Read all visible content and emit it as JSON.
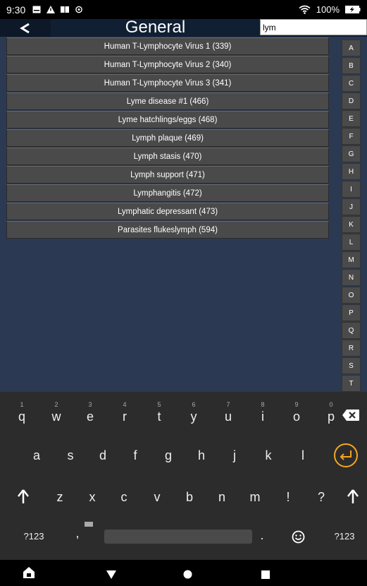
{
  "status_bar": {
    "time": "9:30",
    "battery": "100%"
  },
  "header": {
    "back_label": "<",
    "title": "General",
    "search_value": "lym"
  },
  "results": [
    "Human T-Lymphocyte Virus 1 (339)",
    "Human T-Lymphocyte Virus 2 (340)",
    "Human T-Lymphocyte Virus 3 (341)",
    "Lyme disease #1 (466)",
    "Lyme hatchlings/eggs (468)",
    "Lymph plaque (469)",
    "Lymph stasis (470)",
    "Lymph support (471)",
    "Lymphangitis (472)",
    "Lymphatic depressant (473)",
    "Parasites flukeslymph (594)"
  ],
  "alphabet_index": [
    "A",
    "B",
    "C",
    "D",
    "E",
    "F",
    "G",
    "H",
    "I",
    "J",
    "K",
    "L",
    "M",
    "N",
    "O",
    "P",
    "Q",
    "R",
    "S",
    "T"
  ],
  "keyboard": {
    "row1": [
      {
        "ch": "q",
        "hint": "1"
      },
      {
        "ch": "w",
        "hint": "2"
      },
      {
        "ch": "e",
        "hint": "3"
      },
      {
        "ch": "r",
        "hint": "4"
      },
      {
        "ch": "t",
        "hint": "5"
      },
      {
        "ch": "y",
        "hint": "6"
      },
      {
        "ch": "u",
        "hint": "7"
      },
      {
        "ch": "i",
        "hint": "8"
      },
      {
        "ch": "o",
        "hint": "9"
      },
      {
        "ch": "p",
        "hint": "0"
      }
    ],
    "row2": [
      "a",
      "s",
      "d",
      "f",
      "g",
      "h",
      "j",
      "k",
      "l"
    ],
    "row3": [
      "z",
      "x",
      "c",
      "v",
      "b",
      "n",
      "m",
      "!",
      "?"
    ],
    "symbols_label": "?123",
    "comma": ",",
    "period": ".",
    "accent_color": "#f5a623"
  }
}
